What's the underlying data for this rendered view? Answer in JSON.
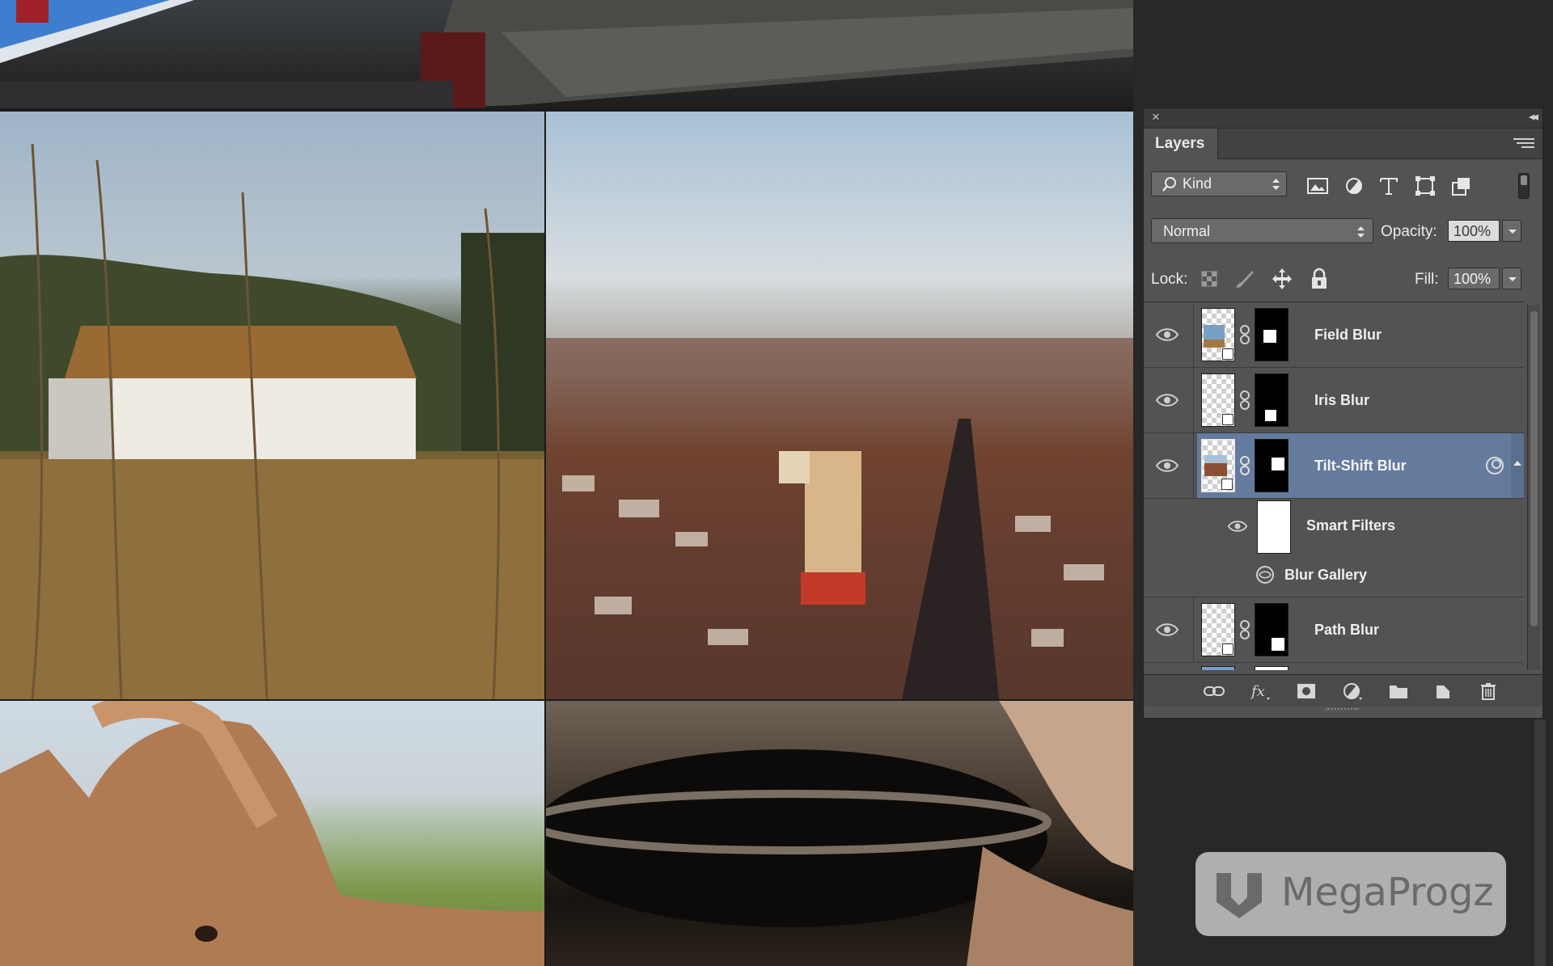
{
  "panel": {
    "close_glyph": "×",
    "collapse_glyph": "◂◂",
    "tab_label": "Layers",
    "filter": {
      "kind_label": "Kind"
    },
    "blend_mode": "Normal",
    "opacity_label": "Opacity:",
    "opacity_value": "100%",
    "lock_label": "Lock:",
    "fill_label": "Fill:",
    "fill_value": "100%",
    "layers": [
      {
        "name": "Field Blur",
        "visible": true,
        "selected": false
      },
      {
        "name": "Iris Blur",
        "visible": true,
        "selected": false
      },
      {
        "name": "Tilt-Shift Blur",
        "visible": true,
        "selected": true
      },
      {
        "name": "Smart Filters",
        "visible": true,
        "selected": false
      },
      {
        "name": "Blur Gallery",
        "visible": true,
        "selected": false
      },
      {
        "name": "Path Blur",
        "visible": true,
        "selected": false
      }
    ],
    "colors": {
      "panel_bg": "#535353",
      "selection": "#647b9e",
      "dark_bg": "#282828"
    }
  },
  "watermark": {
    "text": "MegaProgz"
  }
}
